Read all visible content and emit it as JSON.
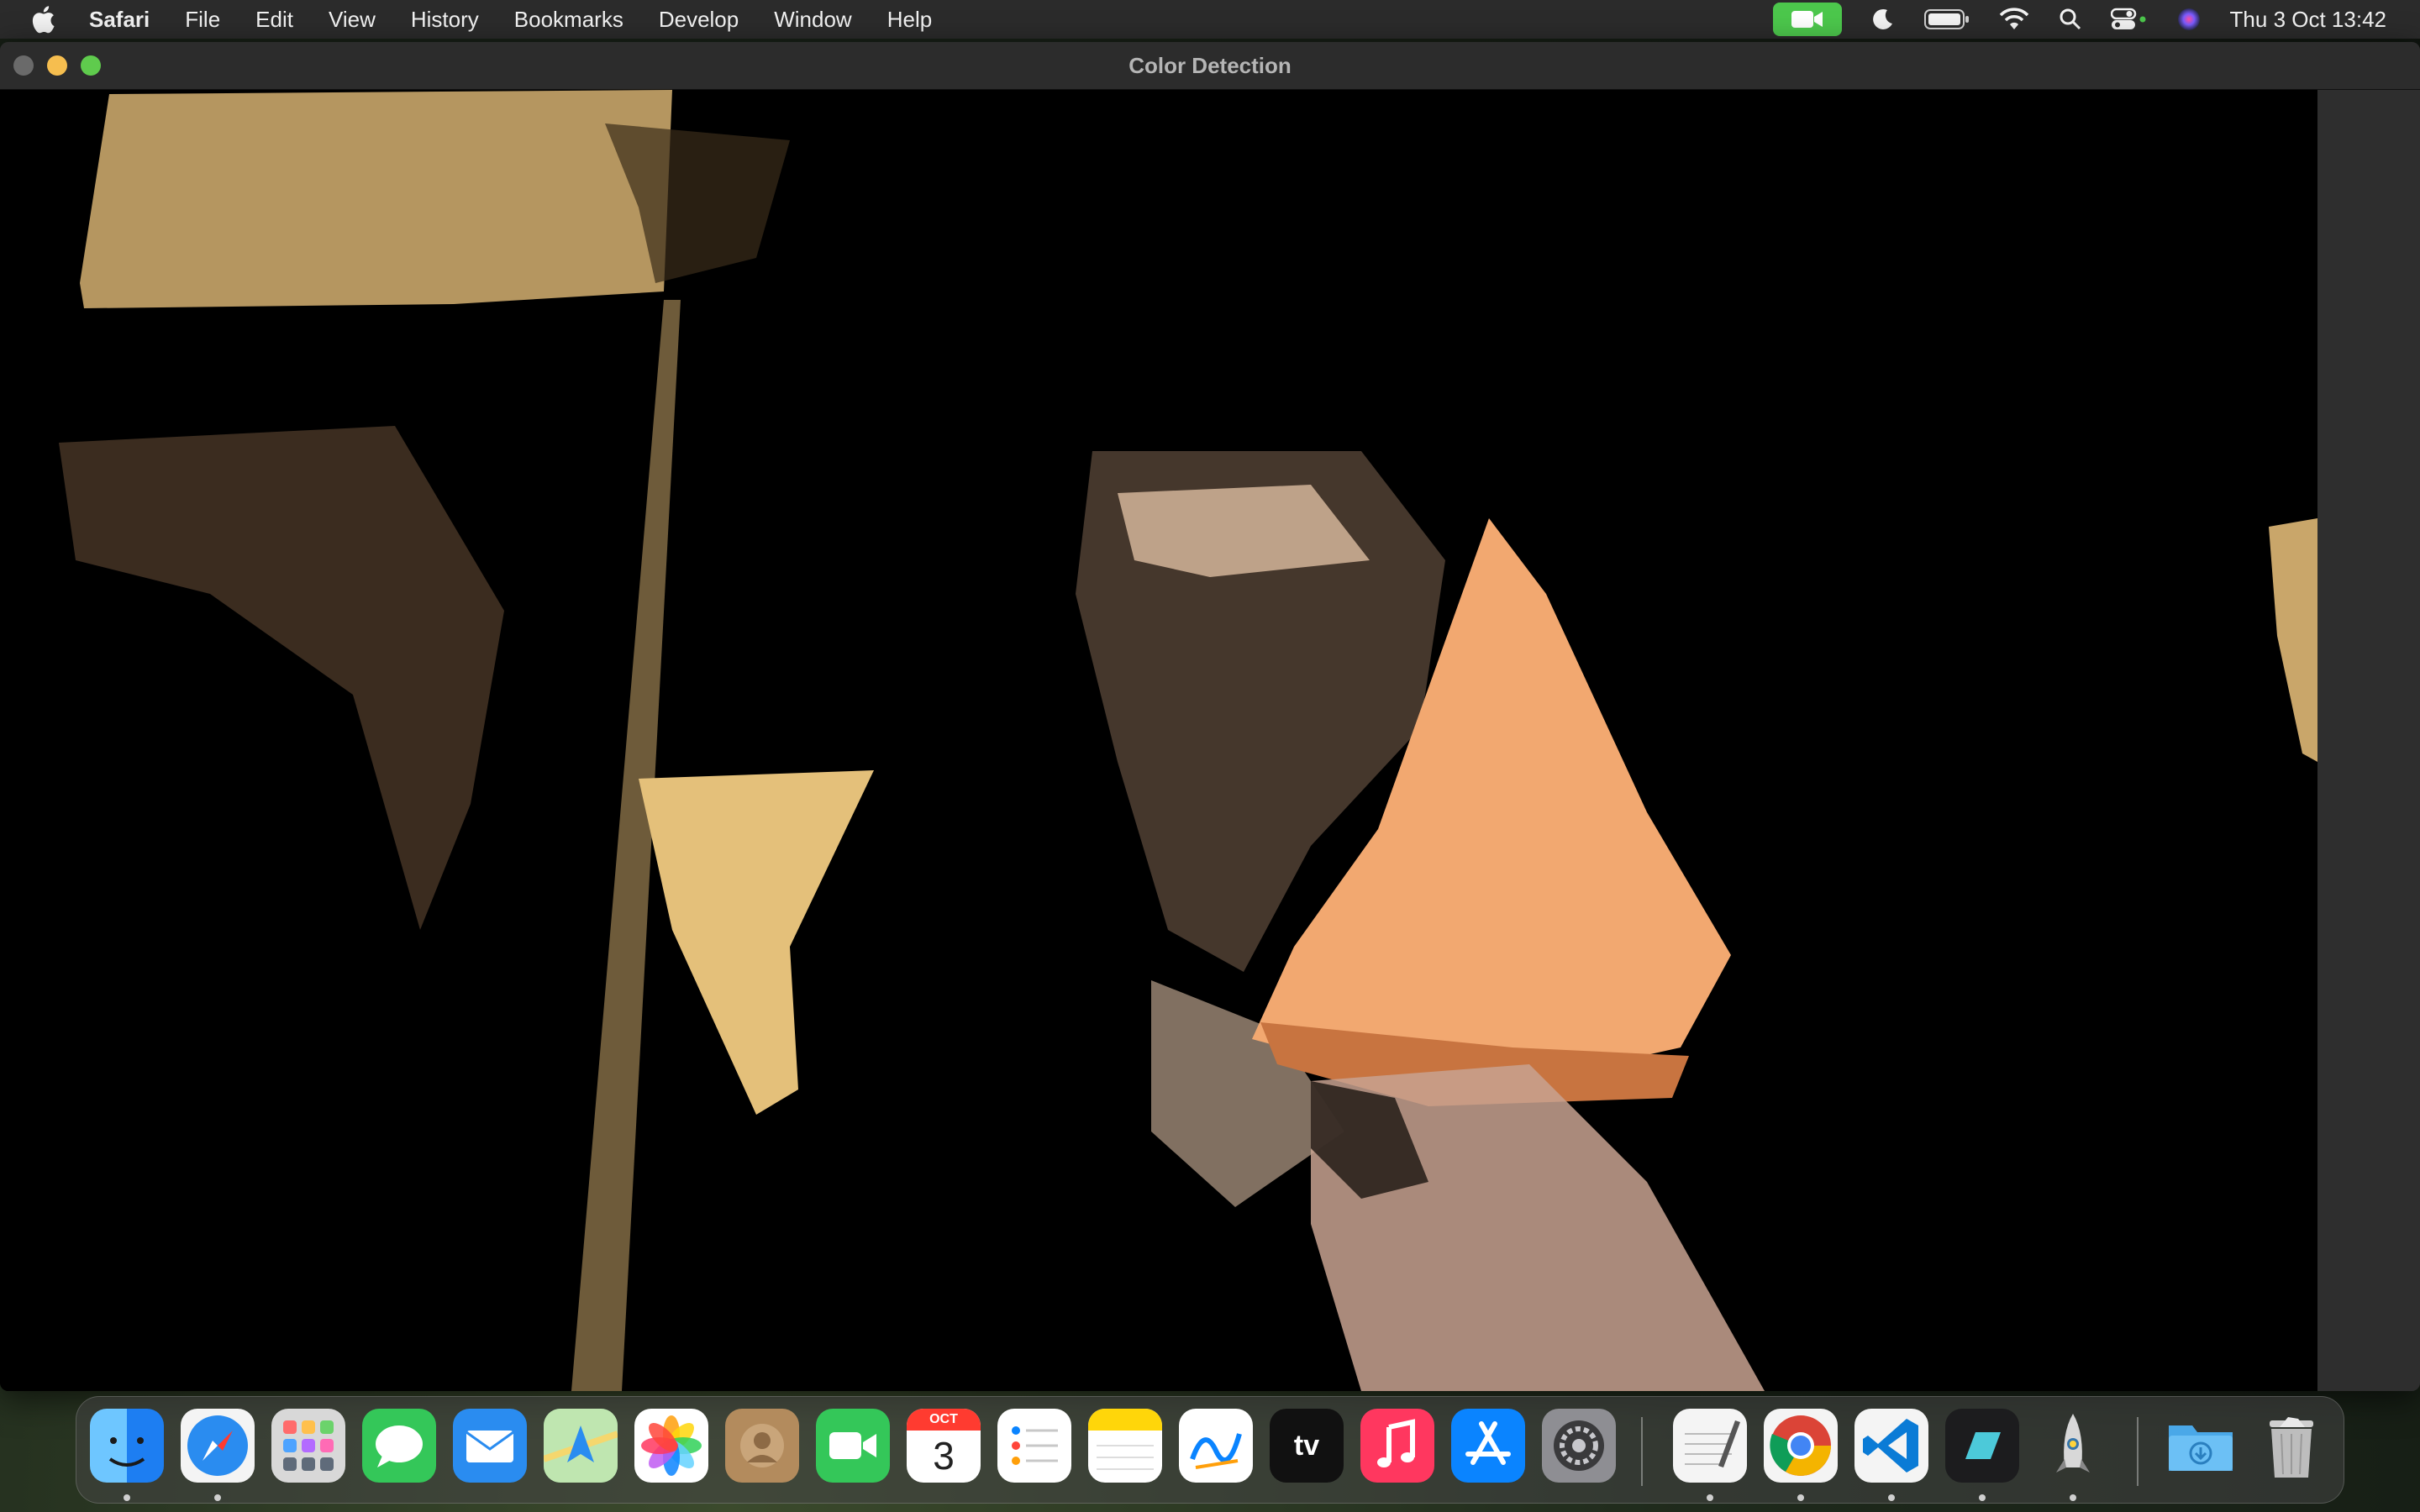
{
  "menubar": {
    "app_name": "Safari",
    "items": [
      "File",
      "Edit",
      "View",
      "History",
      "Bookmarks",
      "Develop",
      "Window",
      "Help"
    ],
    "status_icons": [
      "camera-active-icon",
      "focus-moon-icon",
      "battery-icon",
      "wifi-icon",
      "spotlight-search-icon",
      "control-center-icon",
      "siri-icon"
    ],
    "clock": "Thu 3 Oct  13:42",
    "camera_indicator_color": "#4cc74c"
  },
  "window": {
    "title": "Color Detection",
    "content": "webcam-feed-color-filtered"
  },
  "dock": {
    "apps": [
      {
        "name": "Finder",
        "icon": "finder-icon",
        "running": true
      },
      {
        "name": "Safari",
        "icon": "safari-icon",
        "running": true
      },
      {
        "name": "Launchpad",
        "icon": "launchpad-icon",
        "running": false
      },
      {
        "name": "Messages",
        "icon": "messages-icon",
        "running": false
      },
      {
        "name": "Mail",
        "icon": "mail-icon",
        "running": false
      },
      {
        "name": "Maps",
        "icon": "maps-icon",
        "running": false
      },
      {
        "name": "Photos",
        "icon": "photos-icon",
        "running": false
      },
      {
        "name": "Contacts",
        "icon": "contacts-icon",
        "running": false
      },
      {
        "name": "FaceTime",
        "icon": "facetime-icon",
        "running": false
      },
      {
        "name": "Calendar",
        "icon": "calendar-icon",
        "running": false,
        "month": "OCT",
        "day": "3"
      },
      {
        "name": "Reminders",
        "icon": "reminders-icon",
        "running": false
      },
      {
        "name": "Notes",
        "icon": "notes-icon",
        "running": false
      },
      {
        "name": "Freeform",
        "icon": "freeform-icon",
        "running": false
      },
      {
        "name": "TV",
        "icon": "appletv-icon",
        "running": false,
        "label": "tv"
      },
      {
        "name": "Music",
        "icon": "music-icon",
        "running": false
      },
      {
        "name": "App Store",
        "icon": "appstore-icon",
        "running": false
      },
      {
        "name": "System Settings",
        "icon": "settings-icon",
        "running": false
      },
      {
        "name": "TextEdit",
        "icon": "textedit-icon",
        "running": true
      },
      {
        "name": "Chrome",
        "icon": "chrome-icon",
        "running": true
      },
      {
        "name": "VS Code",
        "icon": "vscode-icon",
        "running": true
      },
      {
        "name": "Xcode-like",
        "icon": "dark-app-icon",
        "running": true
      },
      {
        "name": "Python Launcher",
        "icon": "python-rocket-icon",
        "running": true
      },
      {
        "name": "Downloads",
        "icon": "downloads-folder-icon",
        "running": false
      },
      {
        "name": "Trash",
        "icon": "trash-icon",
        "running": false
      }
    ]
  }
}
